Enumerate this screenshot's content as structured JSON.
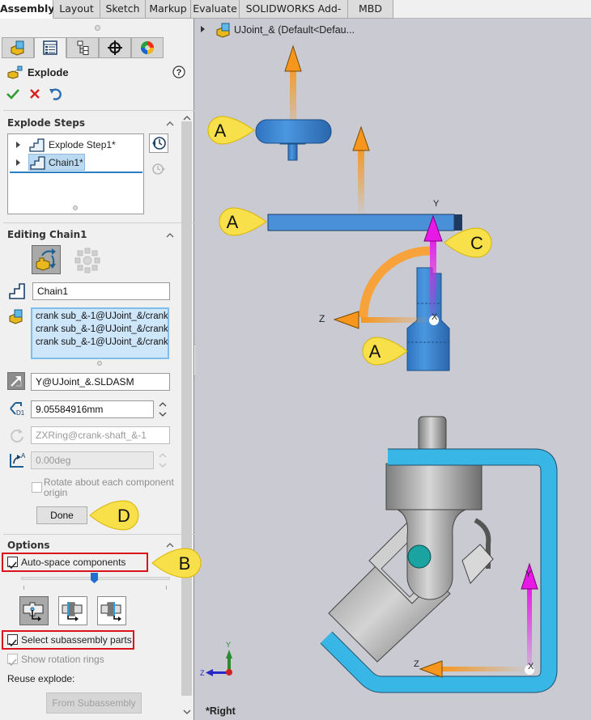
{
  "tabs": [
    {
      "label": "Assembly",
      "active": true
    },
    {
      "label": "Layout"
    },
    {
      "label": "Sketch"
    },
    {
      "label": "Markup"
    },
    {
      "label": "Evaluate"
    },
    {
      "label": "SOLIDWORKS Add-Ins"
    },
    {
      "label": "MBD"
    }
  ],
  "manager_tabs": [
    "feature-manager",
    "property-manager",
    "configuration-manager",
    "dimxpert-manager",
    "display-manager"
  ],
  "property_manager": {
    "title": "Explode",
    "help_icon": "help-icon",
    "actions": [
      "ok-check",
      "cancel-x",
      "undo"
    ]
  },
  "explode_steps": {
    "title": "Explode Steps",
    "items": [
      {
        "label": "Explode Step1*",
        "selected": false
      },
      {
        "label": "Chain1*",
        "selected": true
      }
    ]
  },
  "editing": {
    "title": "Editing Chain1",
    "step_name": "Chain1",
    "components": [
      "crank sub_&-1@UJoint_&/crank",
      "crank sub_&-1@UJoint_&/crank",
      "crank sub_&-1@UJoint_&/crank"
    ],
    "direction": "Y@UJoint_&.SLDASM",
    "distance": "9.05584916mm",
    "rotation_axis": "ZXRing@crank-shaft_&-1",
    "angle": "0.00deg",
    "rotate_about_origin_label": "Rotate about each component origin",
    "rotate_about_origin_checked": false,
    "done_label": "Done"
  },
  "options": {
    "title": "Options",
    "auto_space_label": "Auto-space components",
    "auto_space_checked": true,
    "spacing_slider_value": 0.5,
    "select_subassembly_label": "Select subassembly parts",
    "select_subassembly_checked": true,
    "show_rotation_rings_label": "Show rotation rings",
    "show_rotation_rings_checked": true,
    "reuse_explode_label": "Reuse explode:",
    "from_subassembly_label": "From Subassembly"
  },
  "viewport": {
    "tree_label": "UJoint_&  (Default<Defau...",
    "view_name": "*Right",
    "triad": {
      "y": "Y",
      "z": "Z"
    },
    "axis_labels": {
      "y_top": "Y",
      "z_mid": "Z",
      "x_mid": "X",
      "y_bottom": "Y",
      "z_bottom": "Z",
      "x_bottom": "X"
    }
  },
  "callouts": {
    "a1": "A",
    "a2": "A",
    "a3": "A",
    "b": "B",
    "c": "C",
    "d": "D"
  },
  "colors": {
    "callout_fill": "#f8e04a",
    "highlight_red": "#d9141b",
    "part_blue": "#4a90d9",
    "arrow_orange": "#f7961c",
    "arrow_magenta": "#e619e6",
    "chain_cyan": "#38b6e6"
  }
}
